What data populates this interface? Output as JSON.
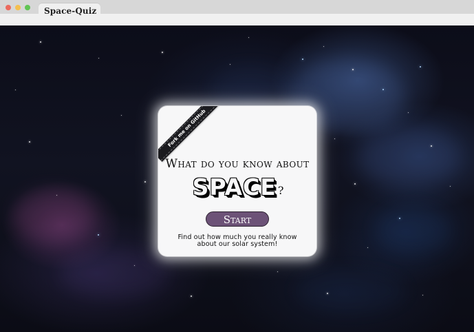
{
  "browser": {
    "tab_title": "Space-Quiz"
  },
  "card": {
    "ribbon_text": "Fork me on GitHub",
    "headline": "What do you know about",
    "title": "SPACE",
    "title_mark": "?",
    "start_label": "Start",
    "description": "Find out how much you really know about our solar system!"
  },
  "colors": {
    "button": "#6c5277",
    "card": "#f7f7f8",
    "ribbon": "#1b1b1f"
  },
  "icons": {
    "close": "red-traffic-light-icon",
    "minimize": "yellow-traffic-light-icon",
    "zoom": "green-traffic-light-icon"
  }
}
